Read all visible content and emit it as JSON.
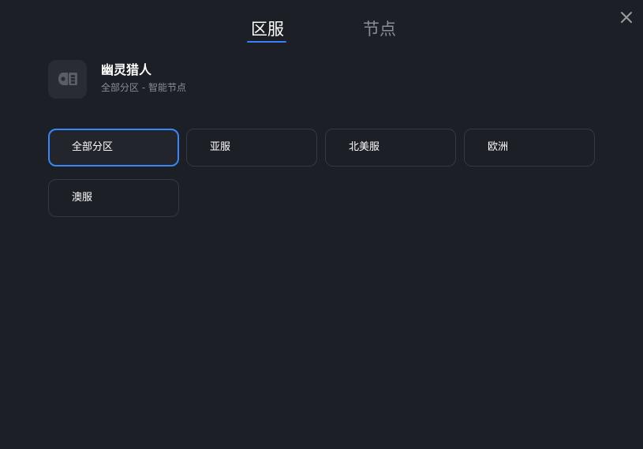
{
  "tabs": [
    {
      "label": "区服",
      "active": true
    },
    {
      "label": "节点",
      "active": false
    }
  ],
  "game": {
    "name": "幽灵猎人",
    "subtitle": "全部分区 - 智能节点",
    "icon": "game-controller-icon"
  },
  "regions": [
    {
      "label": "全部分区",
      "selected": true
    },
    {
      "label": "亚服",
      "selected": false
    },
    {
      "label": "北美服",
      "selected": false
    },
    {
      "label": "欧洲",
      "selected": false
    },
    {
      "label": "澳服",
      "selected": false
    }
  ],
  "colors": {
    "background": "#1d1f26",
    "accent": "#3a7ff6",
    "text_primary": "#ffffff",
    "text_secondary": "#8a8d96",
    "button_border": "#363942"
  },
  "close_icon": "close-icon"
}
